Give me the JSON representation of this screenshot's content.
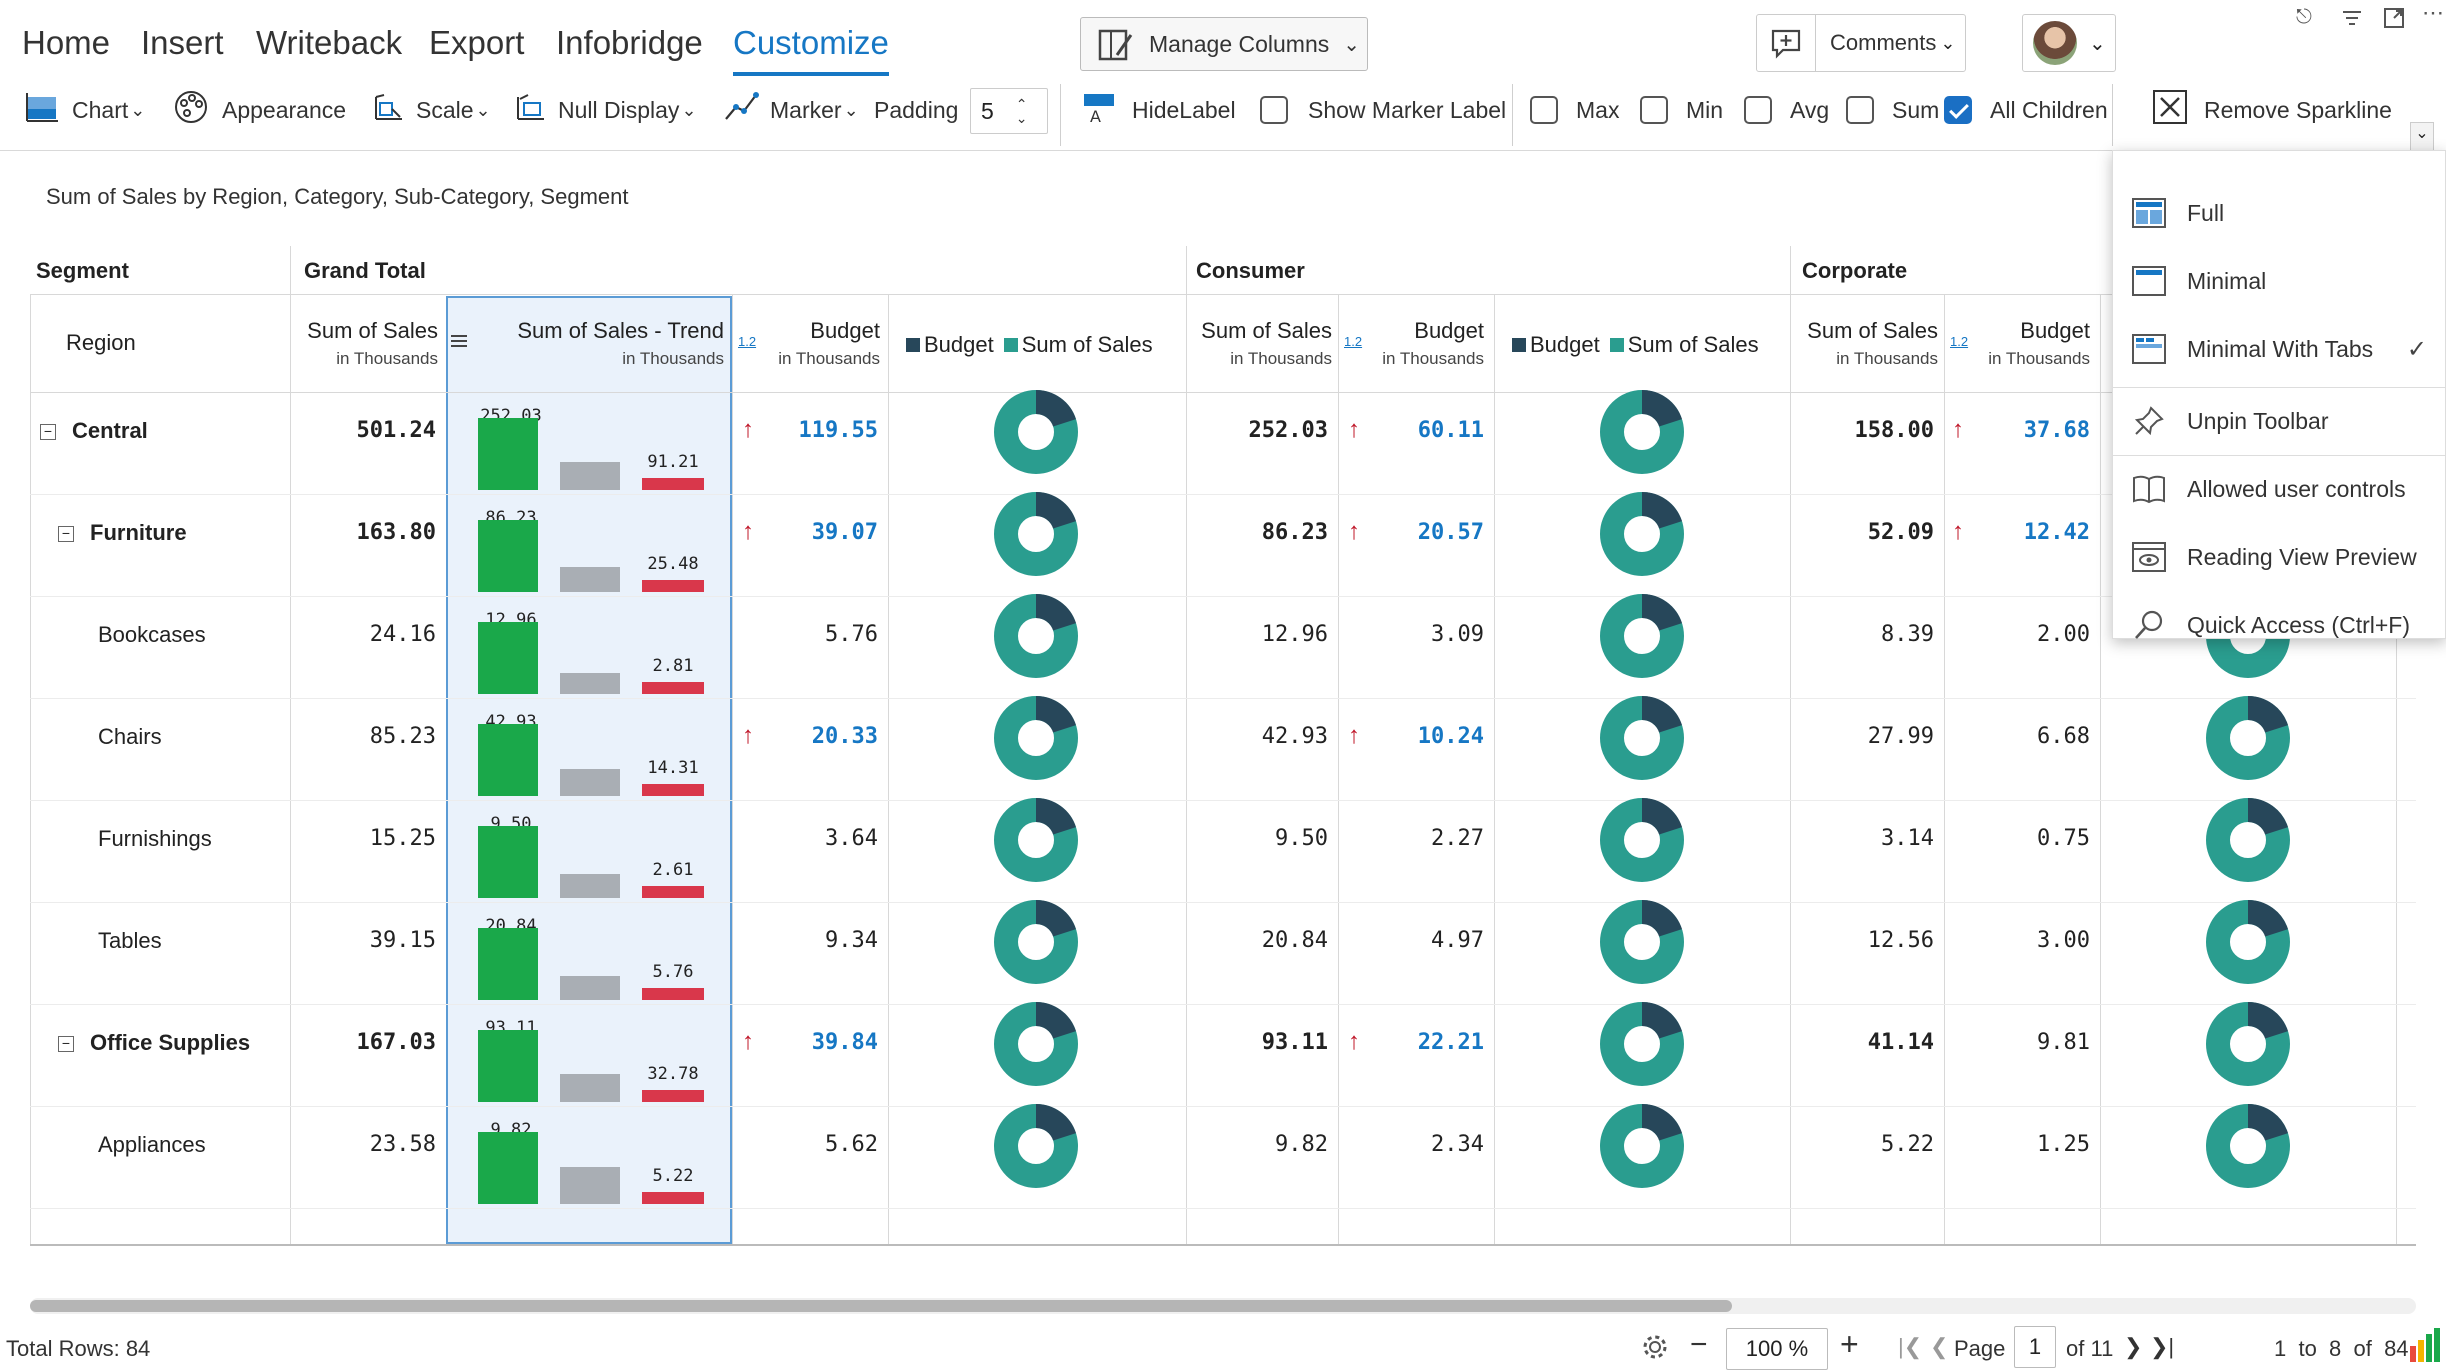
{
  "menu_tabs": [
    "Home",
    "Insert",
    "Writeback",
    "Export",
    "Infobridge",
    "Customize"
  ],
  "active_tab": "Customize",
  "manage_columns": "Manage Columns",
  "comments": "Comments",
  "ribbon": {
    "chart": "Chart",
    "appearance": "Appearance",
    "scale": "Scale",
    "null_display": "Null Display",
    "marker": "Marker",
    "padding_label": "Padding",
    "padding_value": "5",
    "hide_label": "HideLabel",
    "show_marker_label": "Show Marker Label",
    "max": "Max",
    "min": "Min",
    "avg": "Avg",
    "sum": "Sum",
    "all_children": "All Children",
    "remove_sparkline": "Remove Sparkline"
  },
  "report_title": "Sum of Sales by Region, Category, Sub-Category, Segment",
  "headers": {
    "segment": "Segment",
    "region": "Region",
    "grand_total": "Grand Total",
    "consumer": "Consumer",
    "corporate": "Corporate",
    "sum_of_sales": "Sum of Sales",
    "in_thousands": "in Thousands",
    "trend": "Sum of Sales - Trend",
    "budget": "Budget",
    "legend_budget": "Budget",
    "legend_sales": "Sum of Sales",
    "num_icon": "1.2"
  },
  "rows": [
    {
      "label": "Central",
      "level": 0,
      "collapsible": true,
      "bold": true,
      "gt_sales": "501.24",
      "trend_top": "252.03",
      "trend_red": "91.21",
      "gt_budget": "119.55",
      "gt_up": true,
      "c_sales": "252.03",
      "c_budget": "60.11",
      "c_up": true,
      "co_sales": "158.00",
      "co_budget": "37.68",
      "co_up": true
    },
    {
      "label": "Furniture",
      "level": 1,
      "collapsible": true,
      "bold": true,
      "gt_sales": "163.80",
      "trend_top": "86.23",
      "trend_red": "25.48",
      "gt_budget": "39.07",
      "gt_up": true,
      "c_sales": "86.23",
      "c_budget": "20.57",
      "c_up": true,
      "co_sales": "52.09",
      "co_budget": "12.42",
      "co_up": true
    },
    {
      "label": "Bookcases",
      "level": 2,
      "collapsible": false,
      "bold": false,
      "gt_sales": "24.16",
      "trend_top": "12.96",
      "trend_red": "2.81",
      "gt_budget": "5.76",
      "gt_up": false,
      "c_sales": "12.96",
      "c_budget": "3.09",
      "c_up": false,
      "co_sales": "8.39",
      "co_budget": "2.00",
      "co_up": false
    },
    {
      "label": "Chairs",
      "level": 2,
      "collapsible": false,
      "bold": false,
      "gt_sales": "85.23",
      "trend_top": "42.93",
      "trend_red": "14.31",
      "gt_budget": "20.33",
      "gt_up": true,
      "c_sales": "42.93",
      "c_budget": "10.24",
      "c_up": true,
      "co_sales": "27.99",
      "co_budget": "6.68",
      "co_up": false
    },
    {
      "label": "Furnishings",
      "level": 2,
      "collapsible": false,
      "bold": false,
      "gt_sales": "15.25",
      "trend_top": "9.50",
      "trend_red": "2.61",
      "gt_budget": "3.64",
      "gt_up": false,
      "c_sales": "9.50",
      "c_budget": "2.27",
      "c_up": false,
      "co_sales": "3.14",
      "co_budget": "0.75",
      "co_up": false
    },
    {
      "label": "Tables",
      "level": 2,
      "collapsible": false,
      "bold": false,
      "gt_sales": "39.15",
      "trend_top": "20.84",
      "trend_red": "5.76",
      "gt_budget": "9.34",
      "gt_up": false,
      "c_sales": "20.84",
      "c_budget": "4.97",
      "c_up": false,
      "co_sales": "12.56",
      "co_budget": "3.00",
      "co_up": false
    },
    {
      "label": "Office Supplies",
      "level": 1,
      "collapsible": true,
      "bold": true,
      "gt_sales": "167.03",
      "trend_top": "93.11",
      "trend_red": "32.78",
      "gt_budget": "39.84",
      "gt_up": true,
      "c_sales": "93.11",
      "c_budget": "22.21",
      "c_up": true,
      "co_sales": "41.14",
      "co_budget": "9.81",
      "co_up": false
    },
    {
      "label": "Appliances",
      "level": 2,
      "collapsible": false,
      "bold": false,
      "gt_sales": "23.58",
      "trend_top": "9.82",
      "trend_red": "5.22",
      "gt_budget": "5.62",
      "gt_up": false,
      "c_sales": "9.82",
      "c_budget": "2.34",
      "c_up": false,
      "co_sales": "5.22",
      "co_budget": "1.25",
      "co_up": false
    }
  ],
  "toolbar_menu": [
    {
      "label": "Full",
      "icon": "layout-full-icon",
      "checked": false
    },
    {
      "label": "Minimal",
      "icon": "layout-minimal-icon",
      "checked": false
    },
    {
      "label": "Minimal With Tabs",
      "icon": "layout-tabs-icon",
      "checked": true
    },
    {
      "label": "Unpin Toolbar",
      "icon": "pin-icon",
      "checked": false
    },
    {
      "label": "Allowed user controls",
      "icon": "book-icon",
      "checked": false
    },
    {
      "label": "Reading View Preview",
      "icon": "reading-view-icon",
      "checked": false
    },
    {
      "label": "Quick Access (Ctrl+F)",
      "icon": "search-icon",
      "checked": false
    }
  ],
  "footer": {
    "total_rows": "Total Rows: 84",
    "zoom": "100 %",
    "page_label": "Page",
    "page_value": "1",
    "of_pages": "of 11",
    "range": "1  to  8  of  84"
  },
  "colors": {
    "accent": "#1677c4",
    "green": "#1aa84a",
    "gray": "#a9aeb4",
    "red": "#d9374b",
    "teal": "#2a9d8f",
    "navy": "#27475a"
  }
}
